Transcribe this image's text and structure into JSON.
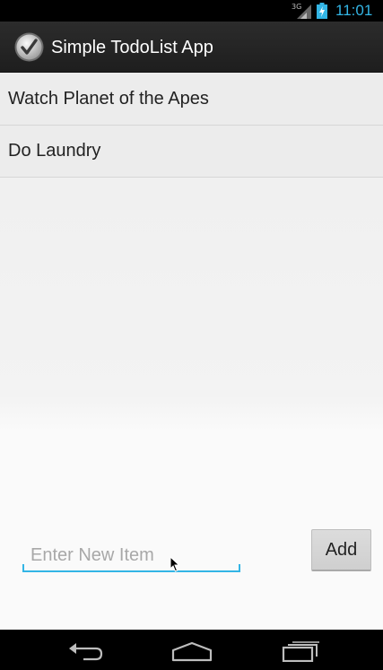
{
  "status_bar": {
    "network_label": "3G",
    "time": "11:01",
    "accent_color": "#33b5e5",
    "icons": [
      "signal-icon",
      "battery-charging-icon"
    ]
  },
  "action_bar": {
    "title": "Simple TodoList App",
    "icon": "checkmark-icon"
  },
  "todo_list": {
    "items": [
      {
        "label": "Watch Planet of the Apes"
      },
      {
        "label": "Do Laundry"
      }
    ]
  },
  "new_item": {
    "placeholder": "Enter New Item",
    "value": "",
    "add_label": "Add"
  },
  "nav_bar": {
    "icons": [
      "back-icon",
      "home-icon",
      "recents-icon"
    ]
  }
}
